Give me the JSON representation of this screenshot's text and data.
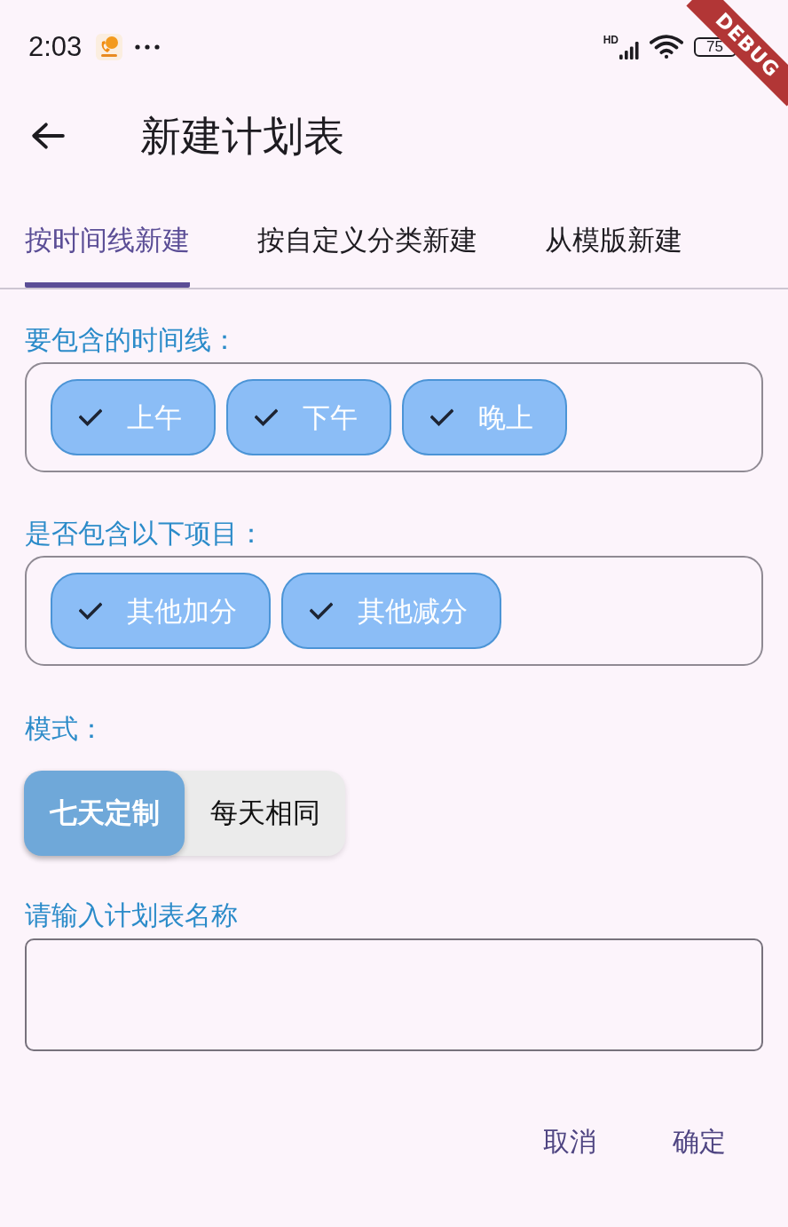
{
  "status_bar": {
    "time": "2:03",
    "network": "HD",
    "battery": "75"
  },
  "debug_banner": {
    "label": "DEBUG"
  },
  "app_bar": {
    "title": "新建计划表"
  },
  "tabs": [
    {
      "label": "按时间线新建",
      "selected": true
    },
    {
      "label": "按自定义分类新建",
      "selected": false
    },
    {
      "label": "从模版新建",
      "selected": false
    }
  ],
  "sections": [
    {
      "label": "要包含的时间线：",
      "chips": [
        {
          "label": "上午",
          "checked": true
        },
        {
          "label": "下午",
          "checked": true
        },
        {
          "label": "晚上",
          "checked": true
        }
      ]
    },
    {
      "label": "是否包含以下项目：",
      "chips": [
        {
          "label": "其他加分",
          "checked": true
        },
        {
          "label": "其他减分",
          "checked": true
        }
      ]
    }
  ],
  "mode": {
    "label": "模式：",
    "options": [
      {
        "label": "七天定制",
        "selected": true
      },
      {
        "label": "每天相同",
        "selected": false
      }
    ]
  },
  "name_field": {
    "label": "请输入计划表名称"
  },
  "actions": [
    "取消",
    "确定"
  ]
}
